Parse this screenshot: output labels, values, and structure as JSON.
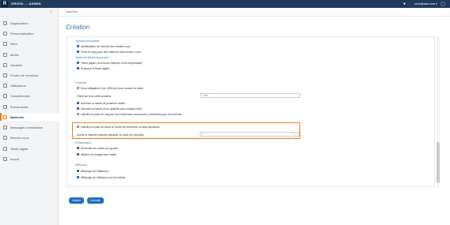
{
  "topbar": {
    "logo": "R",
    "brand": "ORION.....ADMIN",
    "info_icon": "●",
    "user": "orion@aws.com ▾"
  },
  "sidebar": {
    "collapse": "«",
    "items": [
      {
        "label": "Organisation",
        "active": false
      },
      {
        "label": "Personnalisation",
        "active": false
      },
      {
        "label": "Sites",
        "active": false
      },
      {
        "label": "Motifs",
        "active": false
      },
      {
        "label": "Horaires",
        "active": false
      },
      {
        "label": "Postes de réception",
        "active": false
      },
      {
        "label": "Utilisateurs",
        "active": false
      },
      {
        "label": "Compétences",
        "active": false
      },
      {
        "label": "Événements",
        "active": false
      },
      {
        "label": "Matériels",
        "active": true
      },
      {
        "label": "Messages d'orientation",
        "active": false
      },
      {
        "label": "Rendez-vous",
        "active": false
      },
      {
        "label": "Ticket digital",
        "active": false
      },
      {
        "label": "Import",
        "active": false
      }
    ]
  },
  "breadcrumb": "Matériels",
  "help": "?",
  "page_title": "Création",
  "form": {
    "s_options": "Options principales",
    "identification": "Identification de l'arrivée des rendez-vous",
    "prise_rang": "Prise de rang pour des visiteurs sans rendez-vous",
    "s_types": "Types de tickets proposés",
    "ticket_papier": "Ticket papier (si la borne dispose d'une imprimante)",
    "proposer_digital": "Proposer le ticket digital",
    "s_controle": "Contrôle",
    "qrcode": "Sous obligations d'un QRCode pour donner un ticket",
    "filtrer": "Filtrer sur les motifs suivants",
    "filter_placeholder": "Tous",
    "plusieurs": "Autoriser la saisie de plusieurs motifs",
    "quantite": "Autoriser la saisie d'une quantité pour chaque motif",
    "interdire_sans": "Interdire la prise de rang sur les motifs sans ressources connectées pour les recevoir",
    "interdire_fermeture": "Interdire la prise de ticket à l'heure de fermeture ou déjà dépassée",
    "avertir": "Avertir si l'attente estimée dépasse ce seuil (en minutes)",
    "seuil_value": "|",
    "seuil_arrow": "⌃⌄",
    "s_presentation": "Présentation",
    "presenter_groupe": "Présenter les motifs par groupe",
    "afficher_images": "Afficher les images des motifs",
    "s_affluence": "Affluence",
    "affichage_affluence": "Affichage de l'affluence",
    "affichage_tickets": "Affichage de l'affluence sur les tickets"
  },
  "actions": {
    "validate": "Valider",
    "cancel": "Annuler"
  },
  "colors": {
    "topbar": "#1f3b5c",
    "accent": "#f07d18",
    "link": "#2a7ab8",
    "primary_button": "#1f6fc0"
  }
}
